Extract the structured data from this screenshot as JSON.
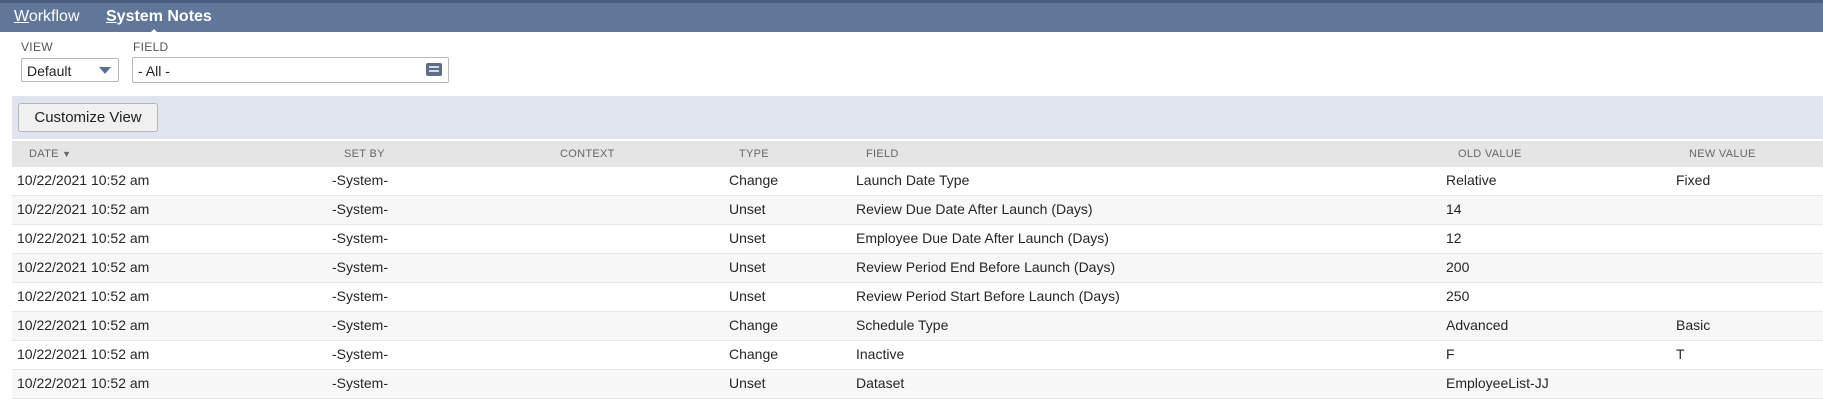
{
  "tabs": {
    "workflow": {
      "first": "W",
      "rest": "orkflow"
    },
    "system_notes": {
      "first": "S",
      "rest": "ystem Notes"
    }
  },
  "filters": {
    "view_label": "VIEW",
    "view_value": "Default",
    "field_label": "FIELD",
    "field_value": "- All -"
  },
  "toolbar": {
    "customize_label": "Customize View"
  },
  "table": {
    "headers": {
      "date": "DATE",
      "sort_indicator": "▼",
      "set_by": "SET BY",
      "context": "CONTEXT",
      "type": "TYPE",
      "field": "FIELD",
      "old_value": "OLD VALUE",
      "new_value": "NEW VALUE"
    },
    "rows": [
      {
        "date": "10/22/2021 10:52 am",
        "set_by": "-System-",
        "context": "",
        "type": "Change",
        "field": "Launch Date Type",
        "old_value": "Relative",
        "new_value": "Fixed"
      },
      {
        "date": "10/22/2021 10:52 am",
        "set_by": "-System-",
        "context": "",
        "type": "Unset",
        "field": "Review Due Date After Launch (Days)",
        "old_value": "14",
        "new_value": ""
      },
      {
        "date": "10/22/2021 10:52 am",
        "set_by": "-System-",
        "context": "",
        "type": "Unset",
        "field": "Employee Due Date After Launch (Days)",
        "old_value": "12",
        "new_value": ""
      },
      {
        "date": "10/22/2021 10:52 am",
        "set_by": "-System-",
        "context": "",
        "type": "Unset",
        "field": "Review Period End Before Launch (Days)",
        "old_value": "200",
        "new_value": ""
      },
      {
        "date": "10/22/2021 10:52 am",
        "set_by": "-System-",
        "context": "",
        "type": "Unset",
        "field": "Review Period Start Before Launch (Days)",
        "old_value": "250",
        "new_value": ""
      },
      {
        "date": "10/22/2021 10:52 am",
        "set_by": "-System-",
        "context": "",
        "type": "Change",
        "field": "Schedule Type",
        "old_value": "Advanced",
        "new_value": "Basic"
      },
      {
        "date": "10/22/2021 10:52 am",
        "set_by": "-System-",
        "context": "",
        "type": "Change",
        "field": "Inactive",
        "old_value": "F",
        "new_value": "T"
      },
      {
        "date": "10/22/2021 10:52 am",
        "set_by": "-System-",
        "context": "",
        "type": "Unset",
        "field": "Dataset",
        "old_value": "EmployeeList-JJ",
        "new_value": ""
      }
    ]
  },
  "colors": {
    "tabbar": "#607799",
    "toolbar": "#dfe4ee",
    "header_row": "#e5e5e5",
    "dropdown_caret": "#5a7097"
  }
}
